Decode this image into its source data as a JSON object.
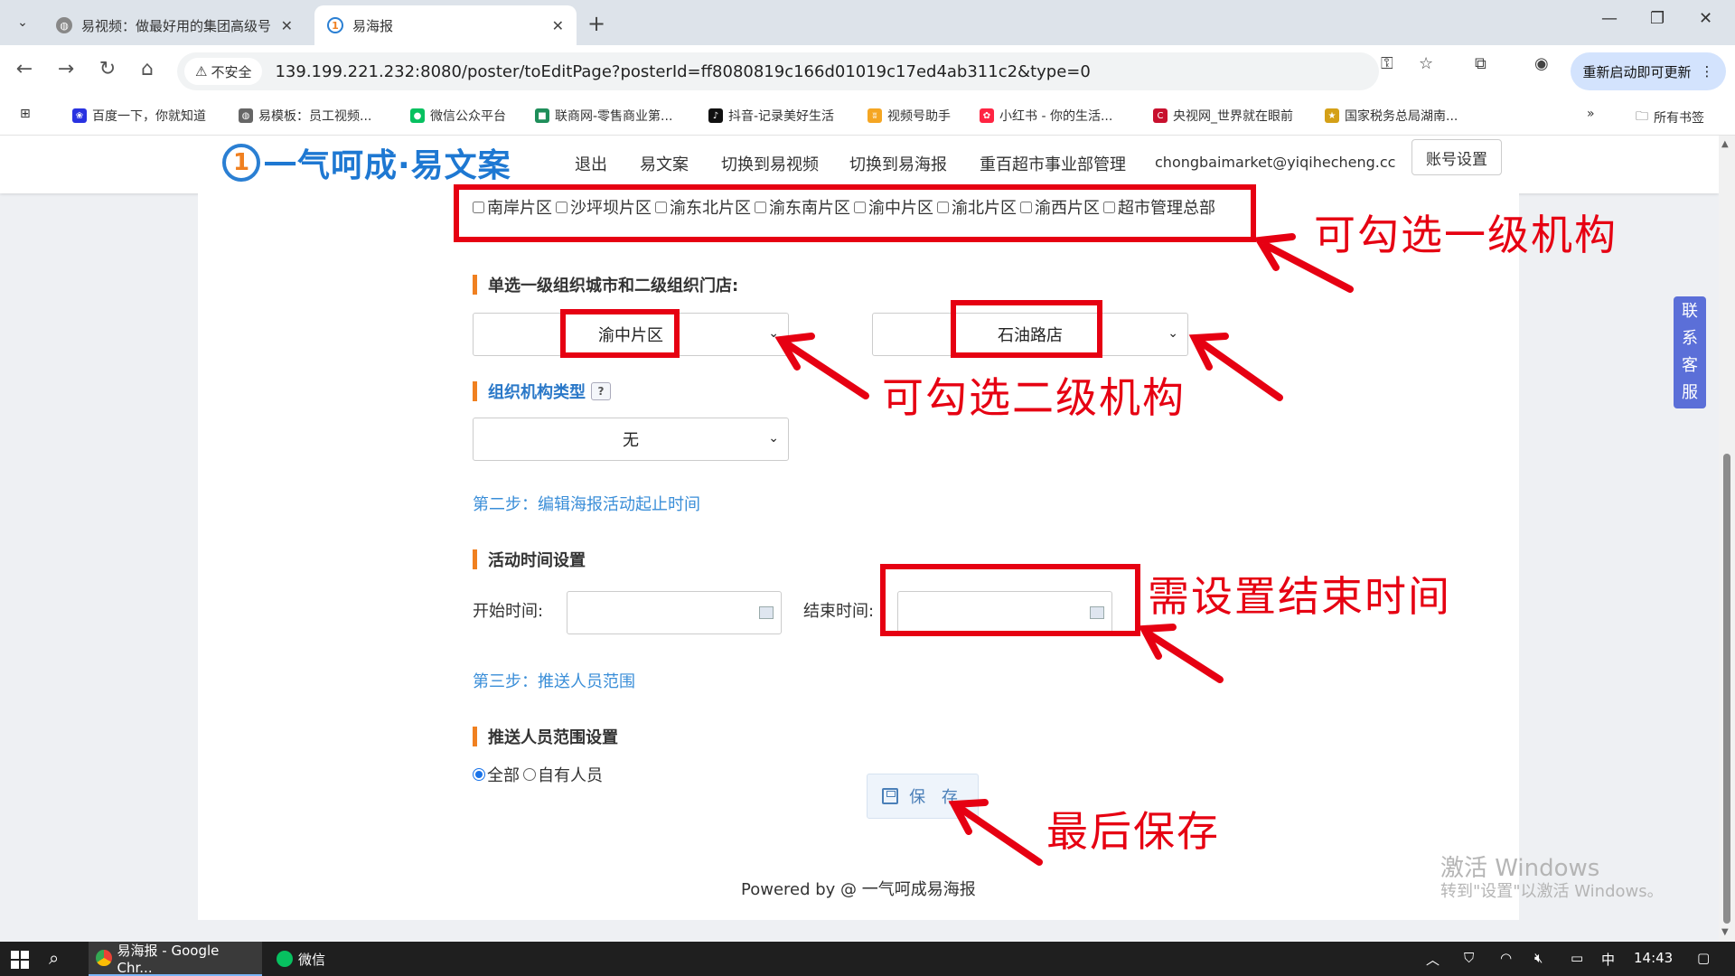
{
  "browser": {
    "tabs": [
      {
        "title": "易视频：做最好用的集团高级号",
        "active": false
      },
      {
        "title": "易海报",
        "active": true
      }
    ],
    "secure_label": "不安全",
    "url": "139.199.221.232:8080/poster/toEditPage?posterId=ff8080819c166d01019c17ed4ab311c2&type=0",
    "update_button": "重新启动即可更新",
    "bookmarks": [
      "百度一下，你就知道",
      "易模板：员工视频...",
      "微信公众平台",
      "联商网-零售商业第...",
      "抖音-记录美好生活",
      "视频号助手",
      "小红书 - 你的生活...",
      "央视网_世界就在眼前",
      "国家税务总局湖南..."
    ],
    "all_bookmarks": "所有书签"
  },
  "site": {
    "logo_text": "一气呵成·易文案",
    "nav": [
      "退出",
      "易文案",
      "切换到易视频",
      "切换到易海报",
      "重百超市事业部管理",
      "chongbaimarket@yiqihecheng.cc"
    ],
    "account_button": "账号设置"
  },
  "form": {
    "level1_options": [
      "南岸片区",
      "沙坪坝片区",
      "渝东北片区",
      "渝东南片区",
      "渝中片区",
      "渝北片区",
      "渝西片区",
      "超市管理总部"
    ],
    "select_section_title": "单选一级组织城市和二级组织门店:",
    "city_select_value": "渝中片区",
    "store_select_value": "石油路店",
    "org_type_title": "组织机构类型",
    "org_type_help": "?",
    "org_type_value": "无",
    "step2": "第二步：编辑海报活动起止时间",
    "time_section_title": "活动时间设置",
    "start_label": "开始时间:",
    "end_label": "结束时间:",
    "start_value": "",
    "end_value": "",
    "step3": "第三步：推送人员范围",
    "push_section_title": "推送人员范围设置",
    "radio_all": "全部",
    "radio_custom": "自有人员",
    "save_button": "保 存",
    "powered": "Powered by @ 一气呵成易海报"
  },
  "annotations": {
    "level1": "可勾选一级机构",
    "level2": "可勾选二级机构",
    "end_time": "需设置结束时间",
    "save": "最后保存"
  },
  "contact_service": [
    "联",
    "系",
    "客",
    "服"
  ],
  "watermark": {
    "line1": "激活 Windows",
    "line2": "转到\"设置\"以激活 Windows。"
  },
  "taskbar": {
    "items": [
      "易海报 - Google Chr...",
      "微信"
    ],
    "ime": "中",
    "time": "14:43"
  },
  "colors": {
    "annotation_red": "#e60012",
    "accent_orange": "#f08020",
    "link_blue": "#3a8ed8",
    "logo_blue": "#1e78d2"
  }
}
